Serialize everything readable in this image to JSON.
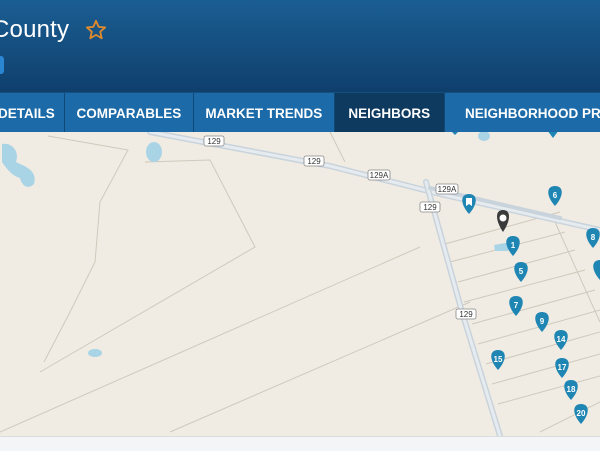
{
  "header": {
    "title": "County",
    "favorite_icon": "star-outline-icon",
    "accent_color": "#e08a2e"
  },
  "tabs": [
    {
      "label": "DETAILS",
      "active": false
    },
    {
      "label": "COMPARABLES",
      "active": false
    },
    {
      "label": "MARKET TRENDS",
      "active": false
    },
    {
      "label": "NEIGHBORS",
      "active": true
    },
    {
      "label": "NEIGHBORHOOD PRO",
      "active": false
    }
  ],
  "map": {
    "road_labels": [
      "129",
      "129",
      "129A",
      "129A",
      "129",
      "129"
    ],
    "markers": [
      "1",
      "5",
      "6",
      "7",
      "8",
      "9",
      "14",
      "15",
      "17",
      "18",
      "20"
    ],
    "subject_marker_icon": "location-pin-icon",
    "unlabeled_marker_icon": "bookmark-icon",
    "marker_color": "#1f86b4"
  }
}
